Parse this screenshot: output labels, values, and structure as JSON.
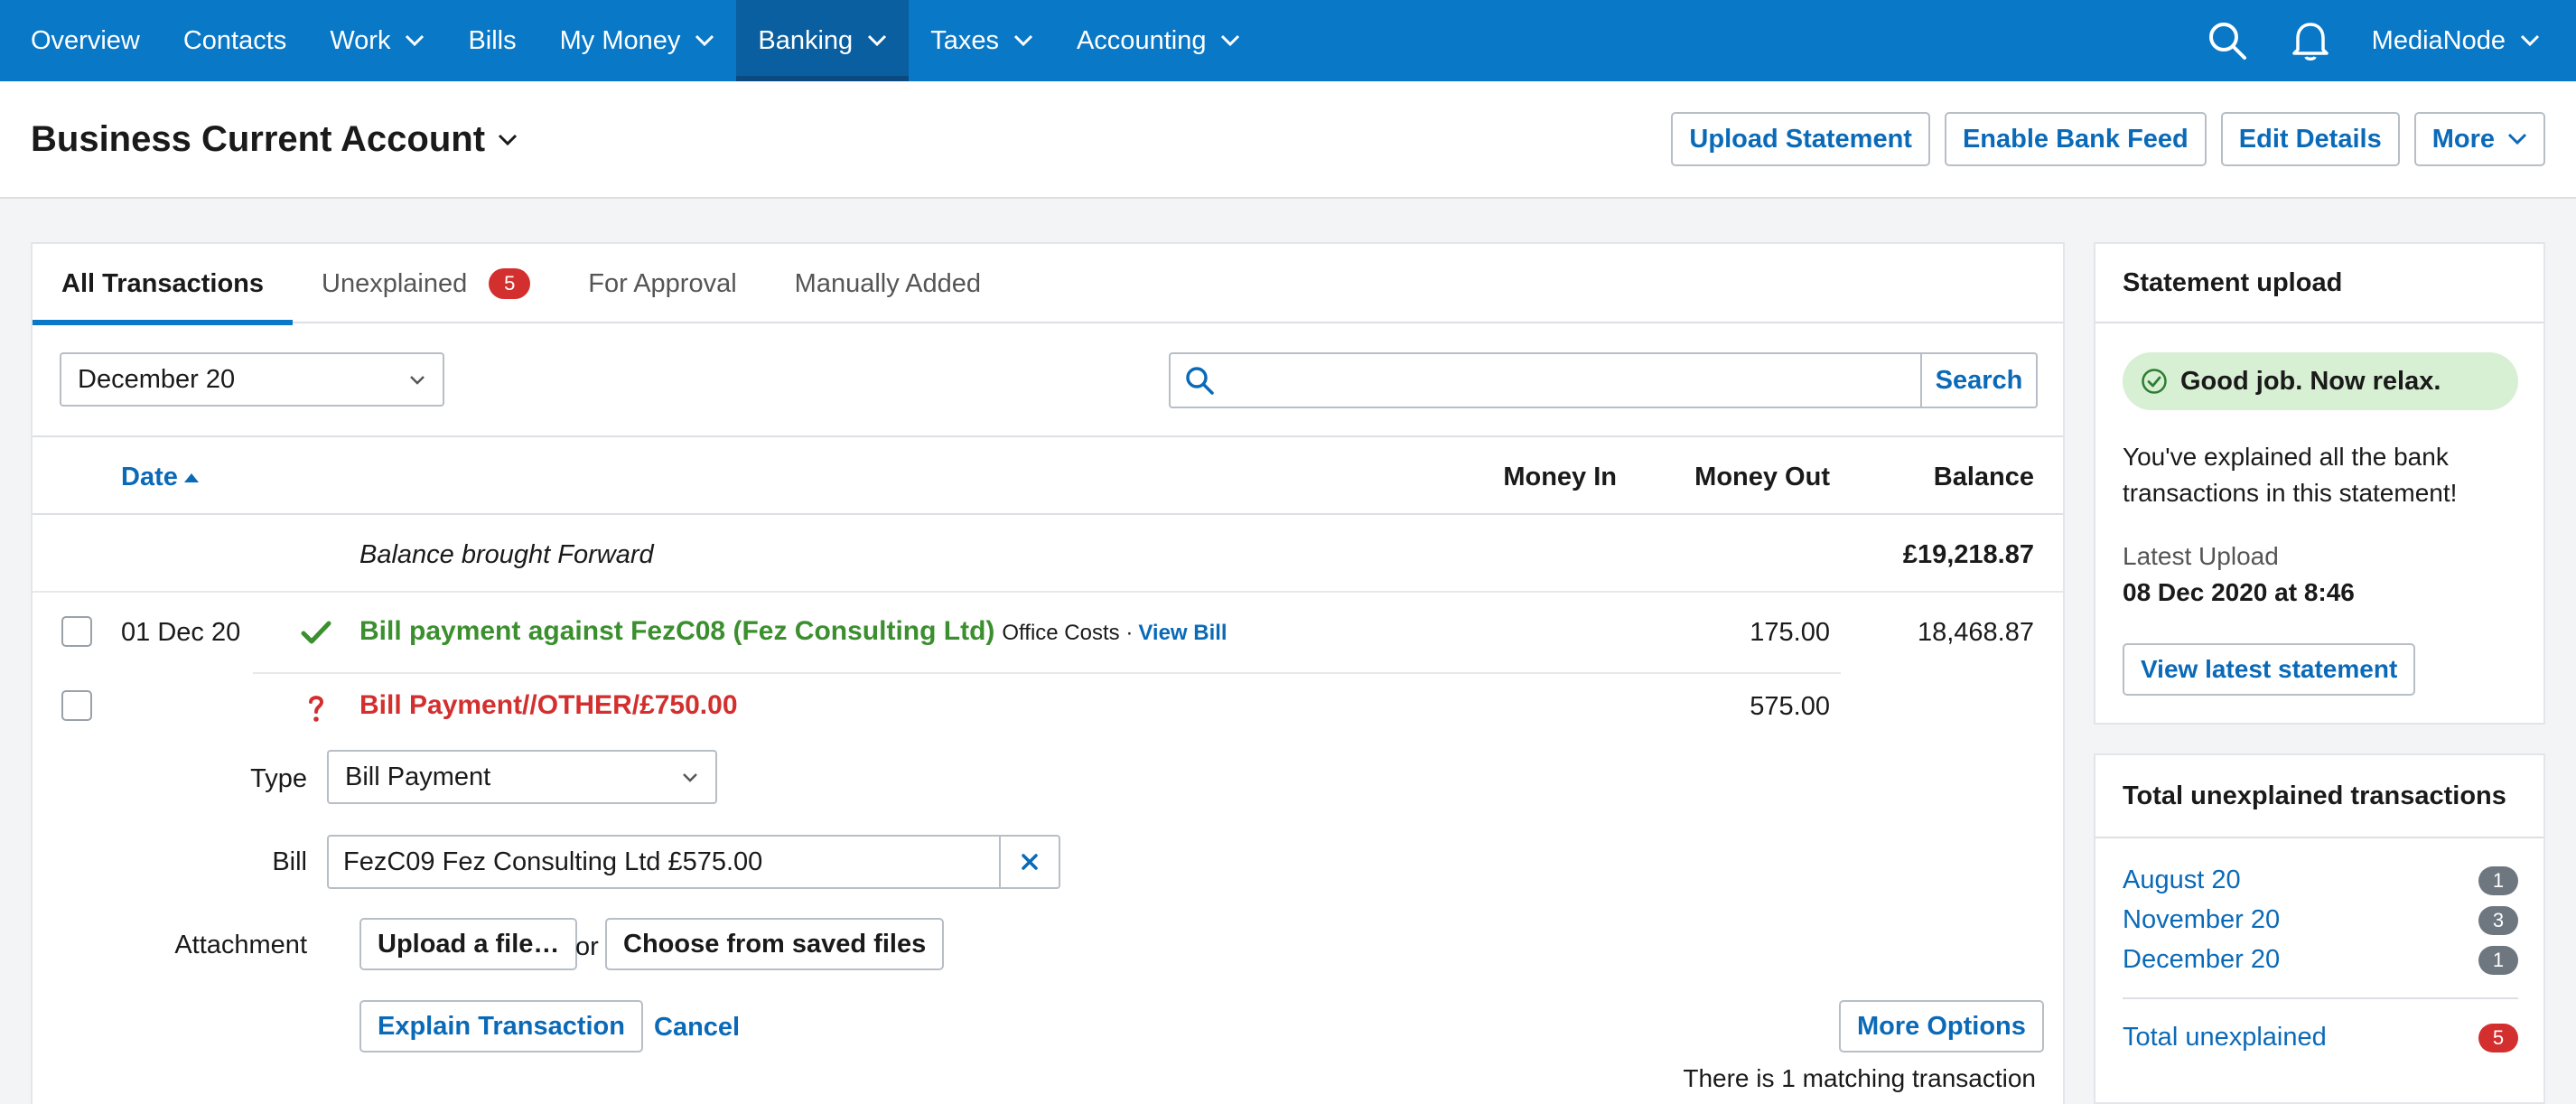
{
  "nav": {
    "items": [
      {
        "label": "Overview",
        "has_menu": false,
        "active": false
      },
      {
        "label": "Contacts",
        "has_menu": false,
        "active": false
      },
      {
        "label": "Work",
        "has_menu": true,
        "active": false
      },
      {
        "label": "Bills",
        "has_menu": false,
        "active": false
      },
      {
        "label": "My Money",
        "has_menu": true,
        "active": false
      },
      {
        "label": "Banking",
        "has_menu": true,
        "active": true
      },
      {
        "label": "Taxes",
        "has_menu": true,
        "active": false
      },
      {
        "label": "Accounting",
        "has_menu": true,
        "active": false
      }
    ],
    "user": "MediaNode"
  },
  "header": {
    "title": "Business Current Account",
    "buttons": {
      "upload": "Upload Statement",
      "bank_feed": "Enable Bank Feed",
      "edit": "Edit Details",
      "more": "More"
    }
  },
  "tabs": [
    {
      "label": "All Transactions",
      "active": true,
      "badge": ""
    },
    {
      "label": "Unexplained",
      "active": false,
      "badge": "5"
    },
    {
      "label": "For Approval",
      "active": false,
      "badge": ""
    },
    {
      "label": "Manually Added",
      "active": false,
      "badge": ""
    }
  ],
  "filter": {
    "period": "December 20",
    "search_placeholder": "",
    "search_button": "Search"
  },
  "columns": {
    "date": "Date",
    "money_in": "Money In",
    "money_out": "Money Out",
    "balance": "Balance"
  },
  "balance_forward": {
    "label": "Balance brought Forward",
    "balance": "£19,218.87"
  },
  "transactions": [
    {
      "date": "01 Dec 20",
      "status": "explained",
      "description": "Bill payment against FezC08 (Fez Consulting Ltd)",
      "category": "Office Costs ·",
      "link": "View Bill",
      "money_out": "175.00",
      "balance": "18,468.87"
    },
    {
      "date": "",
      "status": "unexplained",
      "description": "Bill Payment//OTHER/£750.00",
      "money_out": "575.00",
      "balance": ""
    }
  ],
  "explain_form": {
    "type_label": "Type",
    "type_value": "Bill Payment",
    "bill_label": "Bill",
    "bill_value": "FezC09 Fez Consulting Ltd £575.00",
    "attachment_label": "Attachment",
    "upload_button": "Upload a file…",
    "or_text": "or",
    "saved_files_button": "Choose from saved files",
    "explain_button": "Explain Transaction",
    "cancel_link": "Cancel",
    "more_options_button": "More Options",
    "matching_note": "There is 1 matching transaction"
  },
  "statement_upload": {
    "title": "Statement upload",
    "status": "Good job. Now relax.",
    "message": "You've explained all the bank transactions in this statement!",
    "latest_label": "Latest Upload",
    "latest_value": "08 Dec 2020 at 8:46",
    "view_button": "View latest statement"
  },
  "unexplained_summary": {
    "title": "Total unexplained transactions",
    "months": [
      {
        "label": "August 20",
        "count": "1"
      },
      {
        "label": "November 20",
        "count": "3"
      },
      {
        "label": "December 20",
        "count": "1"
      }
    ],
    "total_label": "Total unexplained",
    "total_count": "5"
  },
  "colors": {
    "nav_bg": "#0978c7",
    "nav_active": "#0a5fa1",
    "link": "#0a6ab8",
    "explained": "#3b8f2e",
    "unexplained": "#d32f2f",
    "badge_red": "#d32f2f",
    "success_bg": "#d7efd2"
  }
}
